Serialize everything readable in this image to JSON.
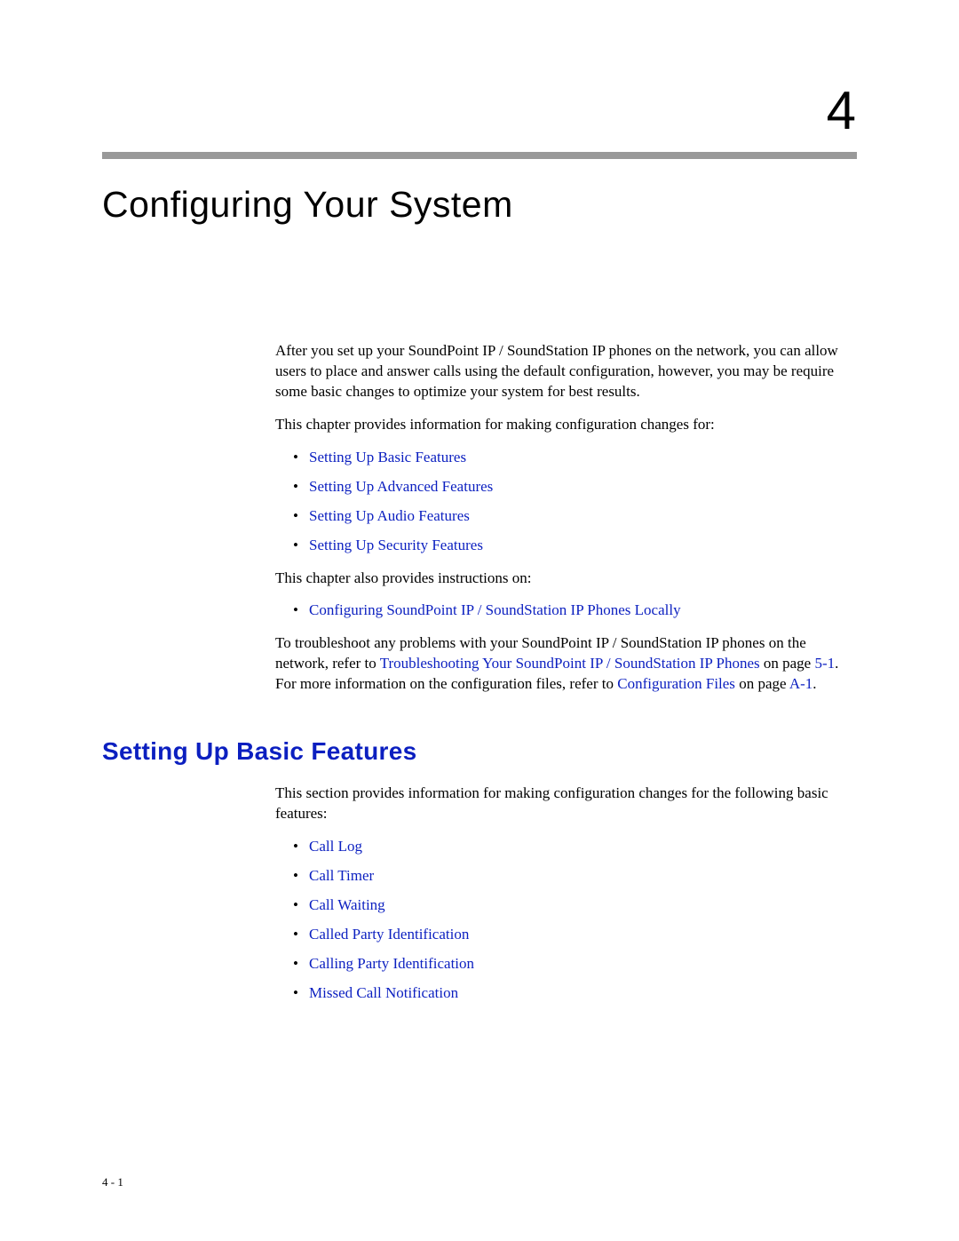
{
  "chapter": {
    "number": "4",
    "title": "Configuring Your System"
  },
  "intro": {
    "p1": "After you set up your SoundPoint IP / SoundStation IP phones on the network, you can allow users to place and answer calls using the default configuration, however, you may be require some basic changes to optimize your system for best results.",
    "p2": "This chapter provides information for making configuration changes for:",
    "links1": [
      "Setting Up Basic Features",
      "Setting Up Advanced Features",
      "Setting Up Audio Features",
      "Setting Up Security Features"
    ],
    "p3": "This chapter also provides instructions on:",
    "links2": [
      "Configuring SoundPoint IP / SoundStation IP Phones Locally"
    ],
    "p4_pre": "To troubleshoot any problems with your SoundPoint IP / SoundStation IP phones on the network, refer to ",
    "p4_link1": "Troubleshooting Your SoundPoint IP / SoundStation IP Phones",
    "p4_mid1": " on page ",
    "p4_link2": "5-1",
    "p4_mid2": ". For more information on the configuration files, refer to ",
    "p4_link3": "Configuration Files",
    "p4_mid3": " on page ",
    "p4_link4": "A-1",
    "p4_end": "."
  },
  "section1": {
    "title": "Setting Up Basic Features",
    "p1": "This section provides information for making configuration changes for the following basic features:",
    "links": [
      "Call Log",
      "Call Timer",
      "Call Waiting",
      "Called Party Identification",
      "Calling Party Identification",
      "Missed Call Notification"
    ]
  },
  "footer": "4 - 1"
}
